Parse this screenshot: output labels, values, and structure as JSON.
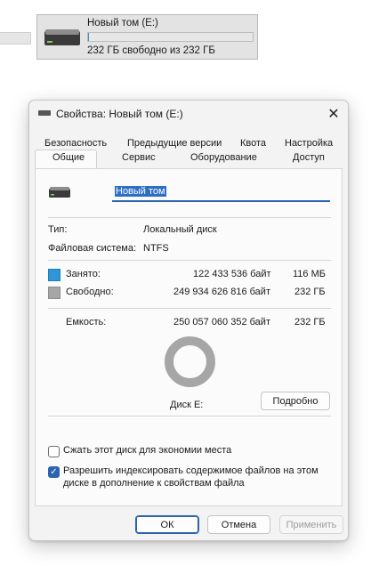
{
  "explorer_tile": {
    "name": "Новый том (E:)",
    "free_text": "232 ГБ свободно из 232 ГБ",
    "usage_fraction": 0.0005
  },
  "dialog": {
    "title": "Свойства: Новый том (E:)",
    "close_glyph": "✕",
    "tabs_row1": [
      "Безопасность",
      "Предыдущие версии",
      "Квота",
      "Настройка"
    ],
    "tabs_row2": [
      "Общие",
      "Сервис",
      "Оборудование",
      "Доступ"
    ],
    "active_tab": "Общие",
    "volume_name": "Новый том",
    "type_label": "Тип:",
    "type_value": "Локальный диск",
    "fs_label": "Файловая система:",
    "fs_value": "NTFS",
    "used": {
      "label": "Занято:",
      "bytes": "122 433 536 байт",
      "short": "116 МБ",
      "color": "#2f97d6"
    },
    "free": {
      "label": "Свободно:",
      "bytes": "249 934 626 816 байт",
      "short": "232 ГБ",
      "color": "#a6a6a6"
    },
    "capacity": {
      "label": "Емкость:",
      "bytes": "250 057 060 352 байт",
      "short": "232 ГБ"
    },
    "disk_label": "Диск E:",
    "details_button": "Подробно",
    "compress_label": "Сжать этот диск для экономии места",
    "compress_checked": false,
    "index_label_line1": "Разрешить индексировать содержимое файлов на этом",
    "index_label_line2": "диске в дополнение к свойствам файла",
    "index_checked": true,
    "check_glyph": "✓",
    "ok_button": "ОК",
    "cancel_button": "Отмена",
    "apply_button": "Применить"
  }
}
